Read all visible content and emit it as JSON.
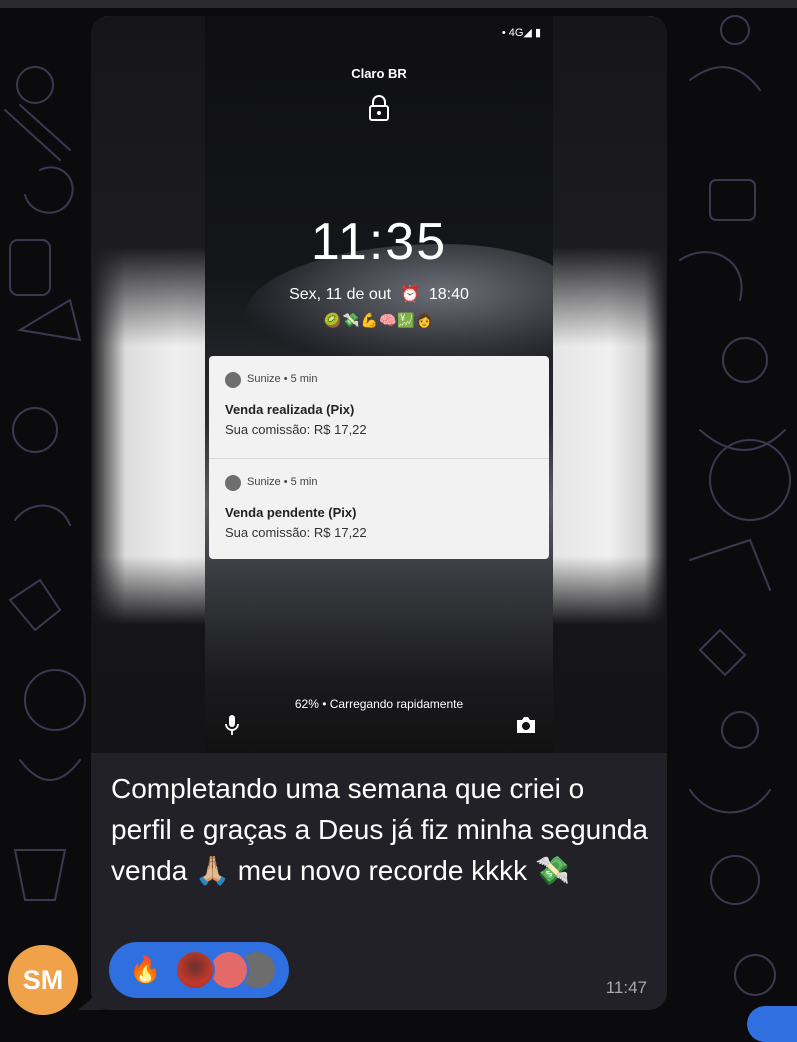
{
  "phone": {
    "status_icons": "• 4G◢ ▮",
    "carrier": "Claro BR",
    "time": "11:35",
    "date": "Sex, 11 de out",
    "alarm_icon": "alarm-icon",
    "alarm_time": "18:40",
    "emoji_row": "🥝💸💪🧠💹👩",
    "battery_text": "62% • Carregando rapidamente",
    "notifications": [
      {
        "app": "Sunize • 5 min",
        "title": "Venda realizada (Pix)",
        "body": "Sua comissão: R$ 17,22"
      },
      {
        "app": "Sunize • 5 min",
        "title": "Venda pendente (Pix)",
        "body": "Sua comissão: R$ 17,22"
      }
    ]
  },
  "message": {
    "caption": "Completando uma semana que criei o perfil e graças a Deus já fiz minha segunda venda 🙏🏼 meu novo recorde kkkk 💸",
    "reaction_emoji": "🔥",
    "time": "11:47"
  },
  "sender": {
    "initials": "SM",
    "avatar_color": "#f0a24a"
  },
  "colors": {
    "bubble": "#222127",
    "reaction_pill": "#2f6fe0",
    "background": "#0b0b0e"
  }
}
